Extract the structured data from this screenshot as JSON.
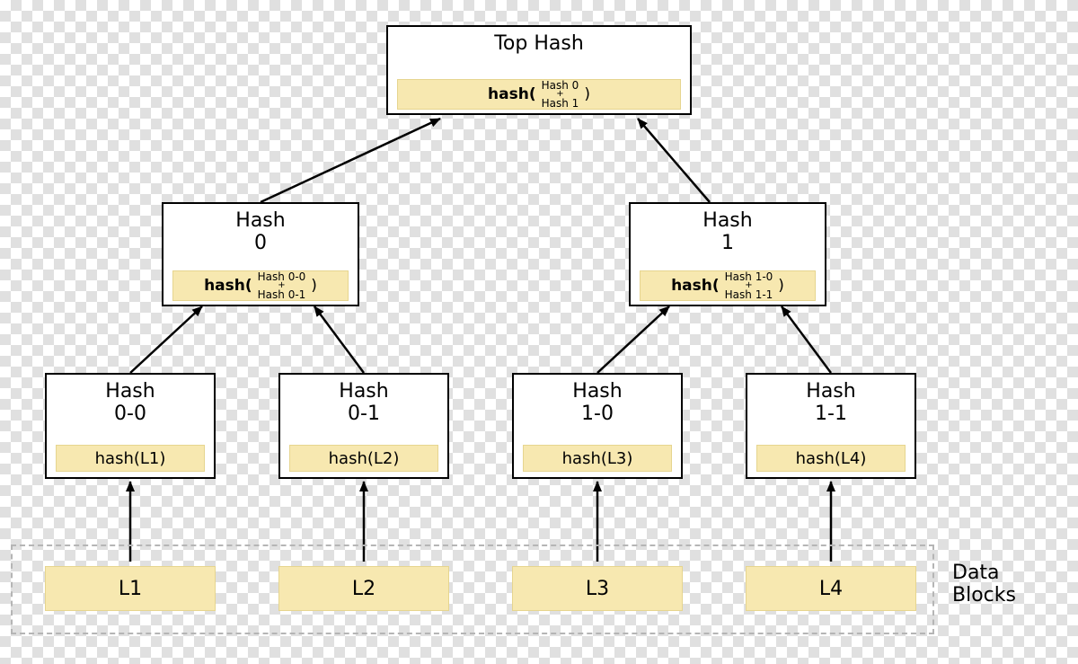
{
  "top": {
    "title": "Top Hash",
    "fn": "hash(",
    "arg_top": "Hash 0",
    "arg_plus": "+",
    "arg_bot": "Hash 1",
    "close": ")"
  },
  "mid": [
    {
      "title": "Hash\n0",
      "fn": "hash(",
      "arg_top": "Hash 0-0",
      "arg_plus": "+",
      "arg_bot": "Hash 0-1",
      "close": ")"
    },
    {
      "title": "Hash\n1",
      "fn": "hash(",
      "arg_top": "Hash 1-0",
      "arg_plus": "+",
      "arg_bot": "Hash 1-1",
      "close": ")"
    }
  ],
  "leaf": [
    {
      "title": "Hash\n0-0",
      "expr": "hash(L1)"
    },
    {
      "title": "Hash\n0-1",
      "expr": "hash(L2)"
    },
    {
      "title": "Hash\n1-0",
      "expr": "hash(L3)"
    },
    {
      "title": "Hash\n1-1",
      "expr": "hash(L4)"
    }
  ],
  "data_blocks": [
    "L1",
    "L2",
    "L3",
    "L4"
  ],
  "data_label": "Data\nBlocks"
}
